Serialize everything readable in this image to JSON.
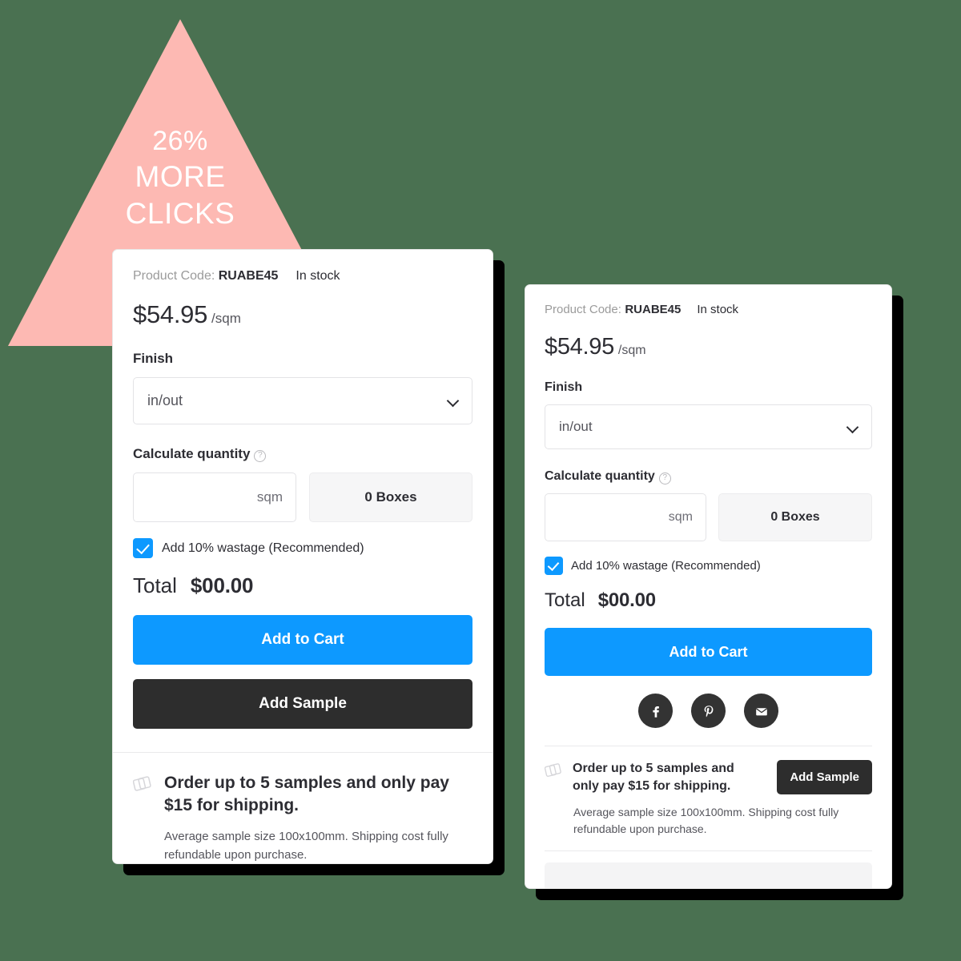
{
  "badge": {
    "percent": "26%",
    "line2": "MORE",
    "line3": "CLICKS",
    "color": "#fdb9b3"
  },
  "theme": {
    "background": "#4a7151",
    "accent_blue": "#0d99ff",
    "dark": "#2d2d2d",
    "pink": "#fdb9b3"
  },
  "variant_a": {
    "product": {
      "code_label": "Product Code:",
      "code": "RUABE45",
      "stock": "In stock",
      "price": "$54.95",
      "price_unit": "/sqm"
    },
    "finish": {
      "label": "Finish",
      "selected": "in/out"
    },
    "quantity": {
      "label": "Calculate quantity",
      "help_icon": "question-circle-icon",
      "input_value": "",
      "input_unit": "sqm",
      "boxes": "0 Boxes"
    },
    "wastage": {
      "label": "Add 10% wastage (Recommended)",
      "checked": true
    },
    "total": {
      "label": "Total",
      "value": "$00.00"
    },
    "actions": {
      "add_to_cart": "Add to Cart",
      "add_sample": "Add Sample"
    },
    "offer": {
      "icon": "sample-swatches-icon",
      "headline": "Order up to 5 samples and only pay $15 for shipping.",
      "subtext": "Average sample size 100x100mm. Shipping cost fully refundable upon purchase."
    }
  },
  "variant_b": {
    "product": {
      "code_label": "Product Code:",
      "code": "RUABE45",
      "stock": "In stock",
      "price": "$54.95",
      "price_unit": "/sqm"
    },
    "finish": {
      "label": "Finish",
      "selected": "in/out"
    },
    "quantity": {
      "label": "Calculate quantity",
      "help_icon": "question-circle-icon",
      "input_value": "",
      "input_unit": "sqm",
      "boxes": "0 Boxes"
    },
    "wastage": {
      "label": "Add 10% wastage (Recommended)",
      "checked": true
    },
    "total": {
      "label": "Total",
      "value": "$00.00"
    },
    "actions": {
      "add_to_cart": "Add to Cart",
      "add_sample": "Add Sample"
    },
    "social": [
      {
        "name": "facebook-icon"
      },
      {
        "name": "pinterest-icon"
      },
      {
        "name": "email-icon"
      }
    ],
    "offer": {
      "icon": "sample-swatches-icon",
      "headline": "Order up to 5 samples and only pay $15 for shipping.",
      "subtext": "Average sample size 100x100mm. Shipping cost fully refundable upon purchase."
    }
  }
}
